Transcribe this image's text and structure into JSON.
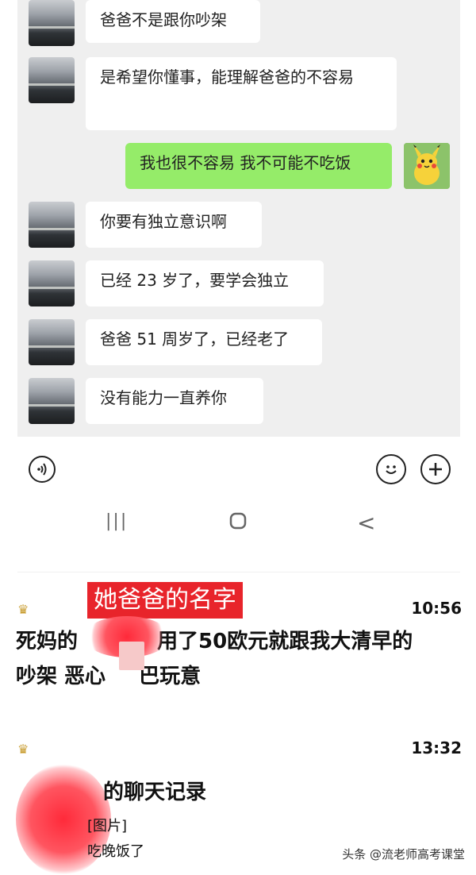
{
  "chat": {
    "messages": [
      {
        "from": "dad",
        "text": "爸爸不是跟你吵架"
      },
      {
        "from": "dad",
        "text": "是希望你懂事，能理解爸爸的不容易"
      },
      {
        "from": "me",
        "text": "我也很不容易 我不可能不吃饭"
      },
      {
        "from": "dad",
        "text": "你要有独立意识啊"
      },
      {
        "from": "dad",
        "text": "已经 23 岁了，要学会独立"
      },
      {
        "from": "dad",
        "text": "爸爸 51 周岁了，已经老了"
      },
      {
        "from": "dad",
        "text": "没有能力一直养你"
      }
    ],
    "icons": {
      "voice": "voice-icon",
      "emoji": "emoji-icon",
      "plus": "plus-icon"
    }
  },
  "nav": {
    "recent": "|||",
    "home": "○",
    "back": "<"
  },
  "annotation": {
    "label": "她爸爸的名字"
  },
  "notifications": [
    {
      "time": "10:56",
      "line1": "死妈的",
      "line1b": "用了50欧元就跟我大清早的",
      "line2": "吵架 恶心",
      "line2b": "巴玩意"
    },
    {
      "time": "13:32",
      "title": "的聊天记录",
      "sub1": "[图片]",
      "sub2": "吃晚饭了"
    }
  ],
  "watermark": "头条 @流老师高考课堂",
  "colors": {
    "my_bubble": "#95ec69",
    "chat_bg": "#efefef",
    "annotation_red": "#e8242b"
  }
}
